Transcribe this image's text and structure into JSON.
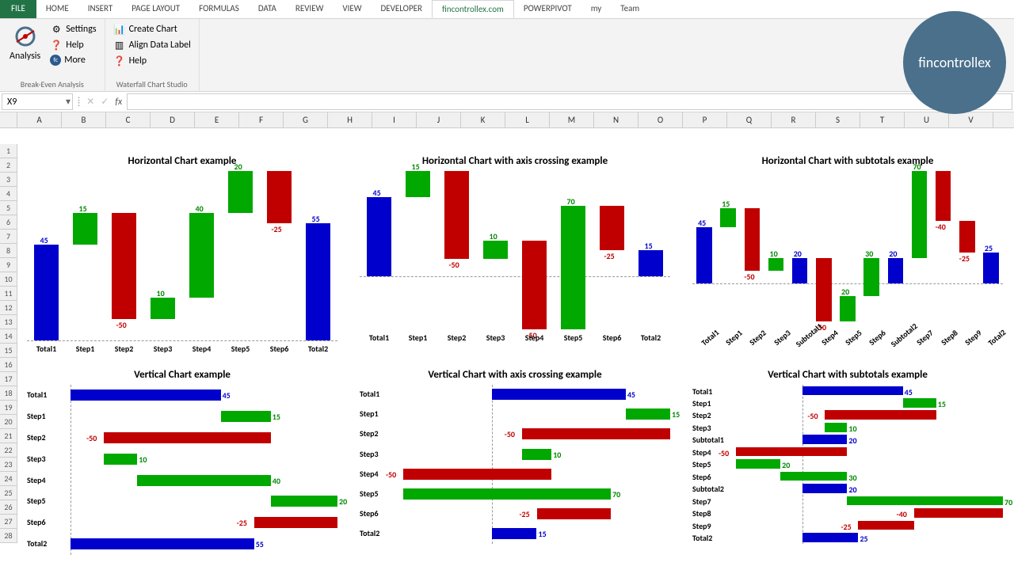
{
  "tabs": {
    "file": "FILE",
    "home": "HOME",
    "insert": "INSERT",
    "page_layout": "PAGE LAYOUT",
    "formulas": "FORMULAS",
    "data": "DATA",
    "review": "REVIEW",
    "view": "VIEW",
    "developer": "DEVELOPER",
    "fincontrollex": "fincontrollex.com",
    "powerpivot": "POWERPIVOT",
    "my": "my",
    "team": "Team"
  },
  "ribbon": {
    "analysis_label": "Analysis",
    "breakeven_group": "Break-Even Analysis",
    "waterfall_group": "Waterfall Chart Studio",
    "settings": "Settings",
    "help1": "Help",
    "more": "More",
    "create_chart": "Create Chart",
    "align_data": "Align Data Label",
    "help2": "Help"
  },
  "brand": "fincontrollex",
  "namebox": "X9",
  "cols": [
    "A",
    "B",
    "C",
    "D",
    "E",
    "F",
    "G",
    "H",
    "I",
    "J",
    "K",
    "L",
    "M",
    "N",
    "O",
    "P",
    "Q",
    "R",
    "S",
    "T",
    "U",
    "V"
  ],
  "chart_titles": {
    "c1": "Horizontal Chart example",
    "c2": "Horizontal Chart with axis crossing example",
    "c3": "Horizontal Chart with subtotals example",
    "c4": "Vertical Chart example",
    "c5": "Vertical Chart with axis crossing example",
    "c6": "Vertical Chart with subtotals example"
  },
  "chart_data": [
    {
      "id": "c1",
      "type": "waterfall-horizontal",
      "title": "Horizontal Chart example",
      "categories": [
        "Total1",
        "Step1",
        "Step2",
        "Step3",
        "Step4",
        "Step5",
        "Step6",
        "Total2"
      ],
      "values": [
        45,
        15,
        -50,
        10,
        40,
        20,
        -25,
        55
      ],
      "kinds": [
        "total",
        "pos",
        "neg",
        "pos",
        "pos",
        "pos",
        "neg",
        "total"
      ]
    },
    {
      "id": "c2",
      "type": "waterfall-horizontal",
      "title": "Horizontal Chart with axis crossing example",
      "categories": [
        "Total1",
        "Step1",
        "Step2",
        "Step3",
        "Step4",
        "Step5",
        "Step6",
        "Total2"
      ],
      "values": [
        45,
        15,
        -50,
        10,
        -50,
        70,
        -25,
        15
      ],
      "kinds": [
        "total",
        "pos",
        "neg",
        "pos",
        "neg",
        "pos",
        "neg",
        "total"
      ]
    },
    {
      "id": "c3",
      "type": "waterfall-horizontal-subtotals",
      "title": "Horizontal Chart with subtotals example",
      "categories": [
        "Total1",
        "Step1",
        "Step2",
        "Step3",
        "Subtotal1",
        "Step4",
        "Step5",
        "Step6",
        "Subtotal2",
        "Step7",
        "Step8",
        "Step9",
        "Total2"
      ],
      "values": [
        45,
        15,
        -50,
        10,
        20,
        -50,
        20,
        30,
        20,
        70,
        -40,
        -25,
        25
      ],
      "kinds": [
        "total",
        "pos",
        "neg",
        "pos",
        "subtotal",
        "neg",
        "pos",
        "pos",
        "subtotal",
        "pos",
        "neg",
        "neg",
        "total"
      ]
    },
    {
      "id": "c4",
      "type": "waterfall-vertical",
      "title": "Vertical Chart example",
      "categories": [
        "Total1",
        "Step1",
        "Step2",
        "Step3",
        "Step4",
        "Step5",
        "Step6",
        "Total2"
      ],
      "values": [
        45,
        15,
        -50,
        10,
        40,
        20,
        -25,
        55
      ],
      "kinds": [
        "total",
        "pos",
        "neg",
        "pos",
        "pos",
        "pos",
        "neg",
        "total"
      ]
    },
    {
      "id": "c5",
      "type": "waterfall-vertical",
      "title": "Vertical Chart with axis crossing example",
      "categories": [
        "Total1",
        "Step1",
        "Step2",
        "Step3",
        "Step4",
        "Step5",
        "Step6",
        "Total2"
      ],
      "values": [
        45,
        15,
        -50,
        10,
        -50,
        70,
        -25,
        15
      ],
      "kinds": [
        "total",
        "pos",
        "neg",
        "pos",
        "neg",
        "pos",
        "neg",
        "total"
      ]
    },
    {
      "id": "c6",
      "type": "waterfall-vertical-subtotals",
      "title": "Vertical Chart with subtotals example",
      "categories": [
        "Total1",
        "Step1",
        "Step2",
        "Step3",
        "Subtotal1",
        "Step4",
        "Step5",
        "Step6",
        "Subtotal2",
        "Step7",
        "Step8",
        "Step9",
        "Total2"
      ],
      "values": [
        45,
        15,
        -50,
        10,
        20,
        -50,
        20,
        30,
        20,
        70,
        -40,
        -25,
        25
      ],
      "kinds": [
        "total",
        "pos",
        "neg",
        "pos",
        "subtotal",
        "neg",
        "pos",
        "pos",
        "subtotal",
        "pos",
        "neg",
        "neg",
        "total"
      ]
    }
  ]
}
